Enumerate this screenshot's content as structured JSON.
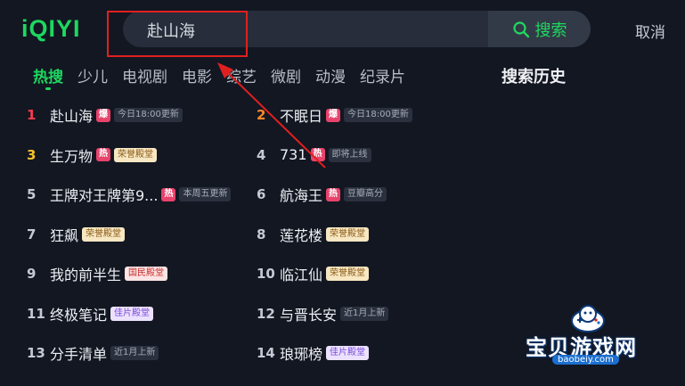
{
  "app": {
    "logo": "iQIYI"
  },
  "search": {
    "query": "赴山海",
    "button_label": "搜索",
    "cancel_label": "取消"
  },
  "tabs": [
    {
      "label": "热搜",
      "active": true
    },
    {
      "label": "少儿"
    },
    {
      "label": "电视剧"
    },
    {
      "label": "电影"
    },
    {
      "label": "综艺"
    },
    {
      "label": "微剧"
    },
    {
      "label": "动漫"
    },
    {
      "label": "纪录片"
    }
  ],
  "history": {
    "title": "搜索历史"
  },
  "ranking": [
    {
      "rank": "1",
      "title": "赴山海",
      "badge": "爆",
      "tag": "今日18:00更新",
      "tag_style": "plain"
    },
    {
      "rank": "2",
      "title": "不眠日",
      "badge": "爆",
      "tag": "今日18:00更新",
      "tag_style": "plain"
    },
    {
      "rank": "3",
      "title": "生万物",
      "badge": "热",
      "tag": "荣誉殿堂",
      "tag_style": "gold"
    },
    {
      "rank": "4",
      "title": "731",
      "badge": "热",
      "tag": "即将上线",
      "tag_style": "plain"
    },
    {
      "rank": "5",
      "title": "王牌对王牌第9...",
      "badge": "热",
      "tag": "本周五更新",
      "tag_style": "plain"
    },
    {
      "rank": "6",
      "title": "航海王",
      "badge": "热",
      "tag": "豆瓣高分",
      "tag_style": "plain"
    },
    {
      "rank": "7",
      "title": "狂飙",
      "badge": "",
      "tag": "荣誉殿堂",
      "tag_style": "gold"
    },
    {
      "rank": "8",
      "title": "莲花楼",
      "badge": "",
      "tag": "荣誉殿堂",
      "tag_style": "gold"
    },
    {
      "rank": "9",
      "title": "我的前半生",
      "badge": "",
      "tag": "国民殿堂",
      "tag_style": "red"
    },
    {
      "rank": "10",
      "title": "临江仙",
      "badge": "",
      "tag": "荣誉殿堂",
      "tag_style": "gold"
    },
    {
      "rank": "11",
      "title": "终极笔记",
      "badge": "",
      "tag": "佳片殿堂",
      "tag_style": "purple"
    },
    {
      "rank": "12",
      "title": "与晋长安",
      "badge": "",
      "tag": "近1月上新",
      "tag_style": "plain"
    },
    {
      "rank": "13",
      "title": "分手清单",
      "badge": "",
      "tag": "近1月上新",
      "tag_style": "plain"
    },
    {
      "rank": "14",
      "title": "琅琊榜",
      "badge": "",
      "tag": "佳片殿堂",
      "tag_style": "purple"
    }
  ],
  "watermark": {
    "text": "宝贝游戏网",
    "url": "baobeiy.com"
  },
  "colors": {
    "accent": "#1ed760",
    "background": "#121722",
    "annotation": "#e0201f"
  }
}
